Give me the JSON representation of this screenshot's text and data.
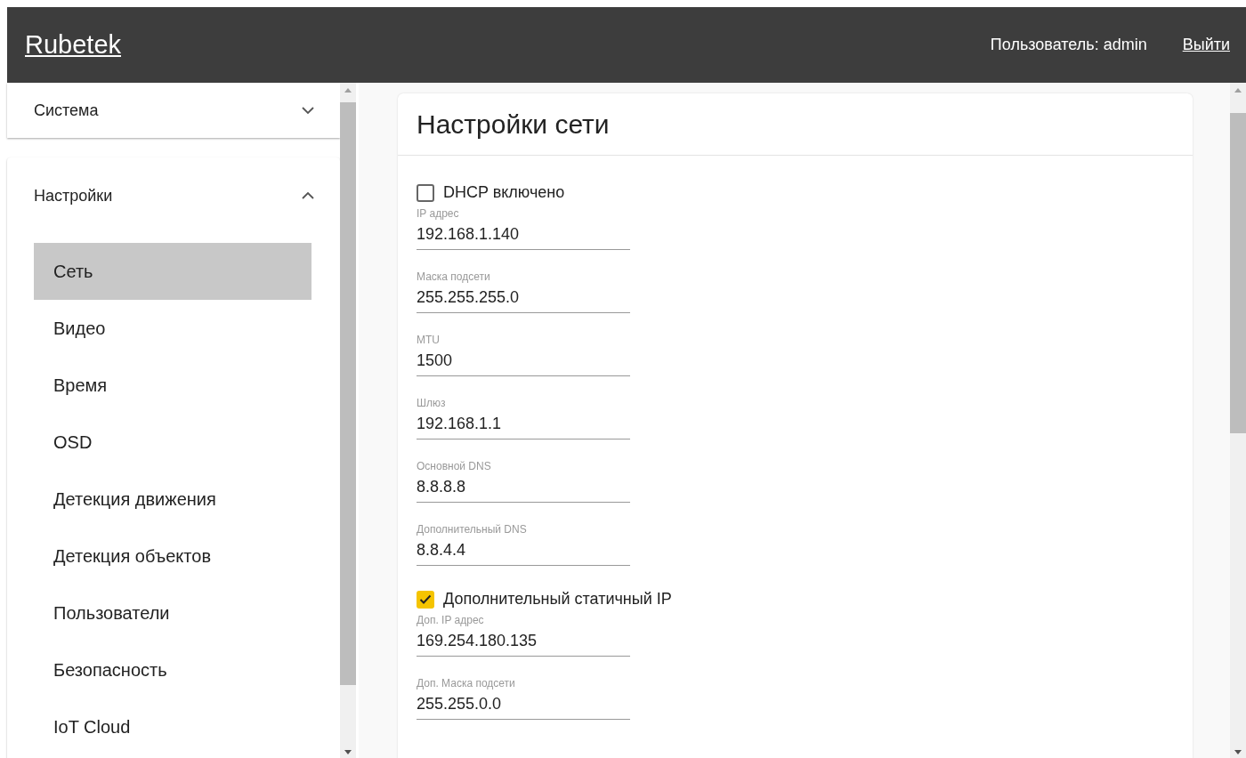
{
  "header": {
    "logo": "Rubetek",
    "user": "Пользователь: admin",
    "logout": "Выйти"
  },
  "sidebar": {
    "sections": [
      {
        "label": "Система",
        "expanded": false
      },
      {
        "label": "Настройки",
        "expanded": true,
        "items": [
          {
            "label": "Сеть",
            "selected": true
          },
          {
            "label": "Видео",
            "selected": false
          },
          {
            "label": "Время",
            "selected": false
          },
          {
            "label": "OSD",
            "selected": false
          },
          {
            "label": "Детекция движения",
            "selected": false
          },
          {
            "label": "Детекция объектов",
            "selected": false
          },
          {
            "label": "Пользователи",
            "selected": false
          },
          {
            "label": "Безопасность",
            "selected": false
          },
          {
            "label": "IoT Cloud",
            "selected": false
          }
        ]
      }
    ]
  },
  "card": {
    "title": "Настройки сети",
    "fields": [
      {
        "kind": "checkbox",
        "label": "DHCP включено",
        "checked": false
      },
      {
        "kind": "field",
        "label": "IP адрес",
        "value": "192.168.1.140"
      },
      {
        "kind": "field",
        "label": "Маска подсети",
        "value": "255.255.255.0"
      },
      {
        "kind": "field",
        "label": "MTU",
        "value": "1500"
      },
      {
        "kind": "field",
        "label": "Шлюз",
        "value": "192.168.1.1"
      },
      {
        "kind": "field",
        "label": "Основной DNS",
        "value": "8.8.8.8"
      },
      {
        "kind": "field",
        "label": "Дополнительный DNS",
        "value": "8.8.4.4"
      },
      {
        "kind": "checkbox",
        "label": "Дополнительный статичный IP",
        "checked": true
      },
      {
        "kind": "field",
        "label": "Доп. IP адрес",
        "value": "169.254.180.135"
      },
      {
        "kind": "field",
        "label": "Доп. Маска подсети",
        "value": "255.255.0.0"
      }
    ]
  }
}
